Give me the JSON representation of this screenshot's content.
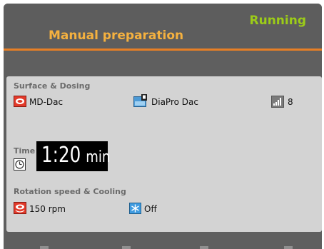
{
  "header": {
    "status": "Running",
    "title": "Manual preparation"
  },
  "colors": {
    "status": "#9ccc18",
    "title": "#f5b13f",
    "accent_line": "#e77f25",
    "panel": "#d3d3d3",
    "background": "#5f5f5f"
  },
  "surface_dosing": {
    "section_label": "Surface & Dosing",
    "surface": "MD-Dac",
    "surface_icon": "polishing-cloth-icon",
    "suspension": "DiaPro Dac",
    "suspension_icon": "dosing-bottle-icon",
    "dosing_level": "8",
    "dosing_icon": "signal-level-icon"
  },
  "time": {
    "section_label": "Time",
    "value": "1:20",
    "unit": "min",
    "icon": "clock-icon"
  },
  "rotation_cooling": {
    "section_label": "Rotation speed & Cooling",
    "speed": "150 rpm",
    "speed_icon": "rotating-disc-icon",
    "cooling": "Off",
    "cooling_icon": "snowflake-icon"
  }
}
